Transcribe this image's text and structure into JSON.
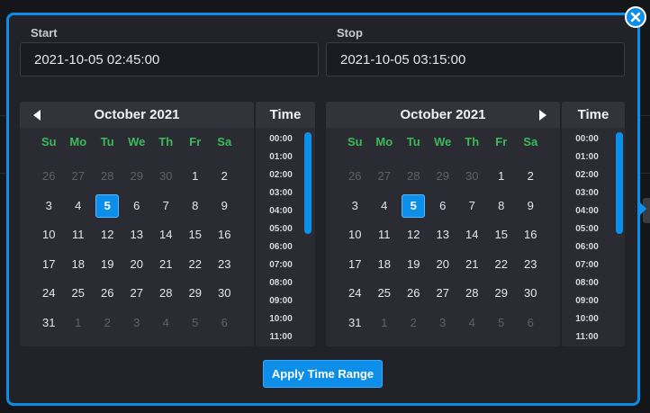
{
  "start": {
    "label": "Start",
    "value": "2021-10-05 02:45:00"
  },
  "stop": {
    "label": "Stop",
    "value": "2021-10-05 03:15:00"
  },
  "colors": {
    "accent": "#0d8fe9",
    "weekday": "#3cba58",
    "panel": "#2b2c33"
  },
  "weekdays": [
    "Su",
    "Mo",
    "Tu",
    "We",
    "Th",
    "Fr",
    "Sa"
  ],
  "calendars": [
    {
      "title": "October 2021",
      "nav_icon": "chevron-left-icon",
      "selected_day": "5",
      "weeks": [
        [
          [
            "26",
            1
          ],
          [
            "27",
            1
          ],
          [
            "28",
            1
          ],
          [
            "29",
            1
          ],
          [
            "30",
            1
          ],
          [
            "1",
            0
          ],
          [
            "2",
            0
          ]
        ],
        [
          [
            "3",
            0
          ],
          [
            "4",
            0
          ],
          [
            "5",
            0
          ],
          [
            "6",
            0
          ],
          [
            "7",
            0
          ],
          [
            "8",
            0
          ],
          [
            "9",
            0
          ]
        ],
        [
          [
            "10",
            0
          ],
          [
            "11",
            0
          ],
          [
            "12",
            0
          ],
          [
            "13",
            0
          ],
          [
            "14",
            0
          ],
          [
            "15",
            0
          ],
          [
            "16",
            0
          ]
        ],
        [
          [
            "17",
            0
          ],
          [
            "18",
            0
          ],
          [
            "19",
            0
          ],
          [
            "20",
            0
          ],
          [
            "21",
            0
          ],
          [
            "22",
            0
          ],
          [
            "23",
            0
          ]
        ],
        [
          [
            "24",
            0
          ],
          [
            "25",
            0
          ],
          [
            "26",
            0
          ],
          [
            "27",
            0
          ],
          [
            "28",
            0
          ],
          [
            "29",
            0
          ],
          [
            "30",
            0
          ]
        ],
        [
          [
            "31",
            0
          ],
          [
            "1",
            1
          ],
          [
            "2",
            1
          ],
          [
            "3",
            1
          ],
          [
            "4",
            1
          ],
          [
            "5",
            1
          ],
          [
            "6",
            1
          ]
        ]
      ]
    },
    {
      "title": "October 2021",
      "nav_icon": "chevron-right-icon",
      "selected_day": "5",
      "weeks": [
        [
          [
            "26",
            1
          ],
          [
            "27",
            1
          ],
          [
            "28",
            1
          ],
          [
            "29",
            1
          ],
          [
            "30",
            1
          ],
          [
            "1",
            0
          ],
          [
            "2",
            0
          ]
        ],
        [
          [
            "3",
            0
          ],
          [
            "4",
            0
          ],
          [
            "5",
            0
          ],
          [
            "6",
            0
          ],
          [
            "7",
            0
          ],
          [
            "8",
            0
          ],
          [
            "9",
            0
          ]
        ],
        [
          [
            "10",
            0
          ],
          [
            "11",
            0
          ],
          [
            "12",
            0
          ],
          [
            "13",
            0
          ],
          [
            "14",
            0
          ],
          [
            "15",
            0
          ],
          [
            "16",
            0
          ]
        ],
        [
          [
            "17",
            0
          ],
          [
            "18",
            0
          ],
          [
            "19",
            0
          ],
          [
            "20",
            0
          ],
          [
            "21",
            0
          ],
          [
            "22",
            0
          ],
          [
            "23",
            0
          ]
        ],
        [
          [
            "24",
            0
          ],
          [
            "25",
            0
          ],
          [
            "26",
            0
          ],
          [
            "27",
            0
          ],
          [
            "28",
            0
          ],
          [
            "29",
            0
          ],
          [
            "30",
            0
          ]
        ],
        [
          [
            "31",
            0
          ],
          [
            "1",
            1
          ],
          [
            "2",
            1
          ],
          [
            "3",
            1
          ],
          [
            "4",
            1
          ],
          [
            "5",
            1
          ],
          [
            "6",
            1
          ]
        ]
      ]
    }
  ],
  "time": {
    "header": "Time",
    "items": [
      "00:00",
      "01:00",
      "02:00",
      "03:00",
      "04:00",
      "05:00",
      "06:00",
      "07:00",
      "08:00",
      "09:00",
      "10:00",
      "11:00"
    ]
  },
  "apply_label": "Apply Time Range",
  "close_icon": "close-icon"
}
